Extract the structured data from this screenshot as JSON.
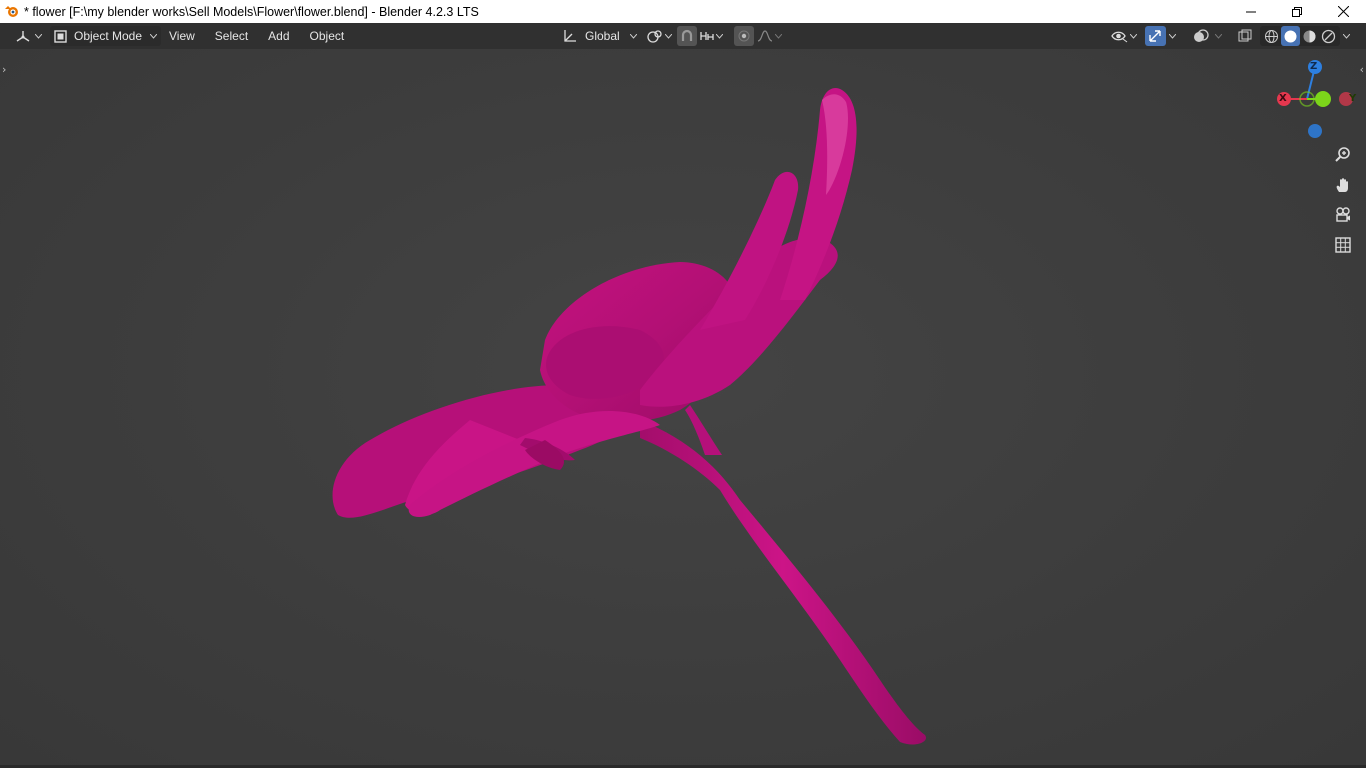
{
  "window": {
    "title": "* flower [F:\\my blender works\\Sell Models\\Flower\\flower.blend] - Blender 4.2.3 LTS",
    "controls": {
      "minimize": "minimize-icon",
      "restore": "restore-icon",
      "close": "close-icon"
    }
  },
  "header": {
    "editor_type_icon": "3d-viewport-icon",
    "mode": {
      "icon": "object-mode-icon",
      "label": "Object Mode"
    },
    "menus": [
      "View",
      "Select",
      "Add",
      "Object"
    ],
    "transform_orientation": {
      "icon": "transform-orientation-icon",
      "label": "Global"
    },
    "pivot_icon": "pivot-point-icon",
    "snap_icon": "snap-magnet-icon",
    "snap_target_icon": "snap-increment-icon",
    "proportional_edit_icon": "proportional-edit-icon",
    "falloff_icon": "falloff-curve-icon",
    "visibility_icon": "eye-icon",
    "gizmo_icon": "gizmo-toggle-icon",
    "overlays_icon": "overlays-icon",
    "xray_icon": "xray-icon",
    "shading_modes": [
      "wireframe",
      "solid",
      "material-preview",
      "rendered"
    ],
    "active_shading": "solid"
  },
  "viewport": {
    "object_color": "#c0127e",
    "background_color": "#3d3d3d",
    "axis_gizmo": {
      "z": "Z",
      "y": "Y",
      "x": "X"
    },
    "axis_colors": {
      "x": "#e5374e",
      "y": "#7cd51a",
      "z": "#2d7fe0"
    },
    "nav_tools": [
      "zoom-icon",
      "hand-pan-icon",
      "camera-icon",
      "grid-ortho-icon"
    ]
  }
}
